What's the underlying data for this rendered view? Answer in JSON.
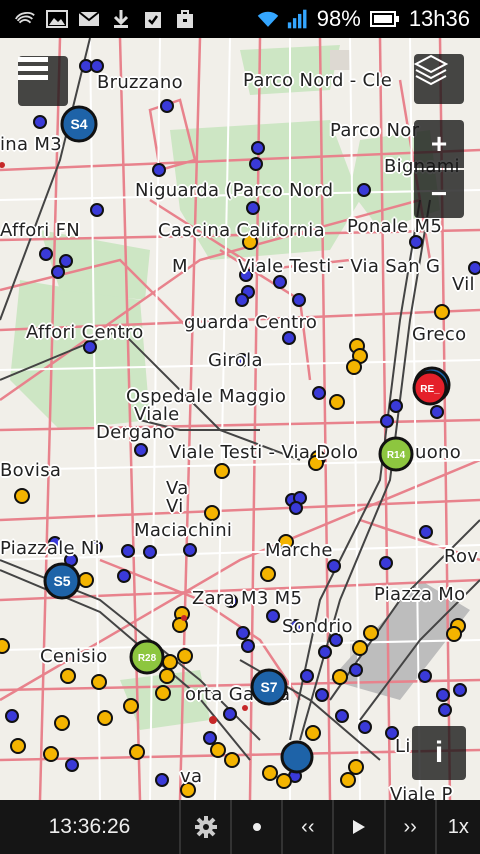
{
  "status_bar": {
    "battery": "98%",
    "clock": "13h36",
    "icons": [
      "carrier-swoosh-icon",
      "image-icon",
      "mail-icon",
      "download-icon",
      "clipboard-check-icon",
      "briefcase-icon",
      "wifi-icon",
      "signal-icon",
      "battery-icon"
    ]
  },
  "map": {
    "labels": {
      "bruzzano": "Bruzzano",
      "parco_nord_cle": "Parco Nord - Cle",
      "parco_nord_2": "Parco Nor",
      "bignami": "Bignami",
      "ina_m3": "ina M3",
      "niguarda": "Niguarda (Parco Nord",
      "affori_fn": "Affori FN",
      "cascina": "Cascina California",
      "ponale": "Ponale M5",
      "viale_testi_san": "Viale Testi - Via San G",
      "vil": "Vil",
      "m_single": "M",
      "guarda_centro": "guarda Centro",
      "affori_centro": "Affori Centro",
      "greco": "Greco",
      "girola": "Girola",
      "ospedale": "Ospedale Maggio",
      "viale": "Viale",
      "dergano": "Dergano",
      "viale_testi_dolo": "Viale Testi - Via Dolo",
      "uono": "uono",
      "bovisa": "Bovisa",
      "va": "Va",
      "vi": "Vi",
      "maciachini": "Maciachini",
      "piazzale": "Piazzale Ni",
      "marche": "Marche",
      "rov": "Rov",
      "zara": "Zara M3 M5",
      "piazza_mo": "Piazza Mo",
      "sondrio": "Sondrio",
      "cenisio": "Cenisio",
      "porta": "orta Gariba",
      "va2": "va",
      "li": "Li",
      "viale_p": "Viale P"
    },
    "line_badges": [
      "S4",
      "S5",
      "S7",
      "R14",
      "R28",
      "RE_"
    ],
    "controls": {
      "zoom_in": "+",
      "zoom_out": "−",
      "info": "i"
    },
    "colors": {
      "bus_stop": "#3a3ad8",
      "tram_stop": "#f4b400",
      "suburban_line": "#1e63a8",
      "regional_line": "#8dc63f",
      "regio_express": "#e5202a"
    }
  },
  "player": {
    "time": "13:36:26",
    "rewind": "‹‹",
    "forward": "››",
    "speed": "1x"
  }
}
